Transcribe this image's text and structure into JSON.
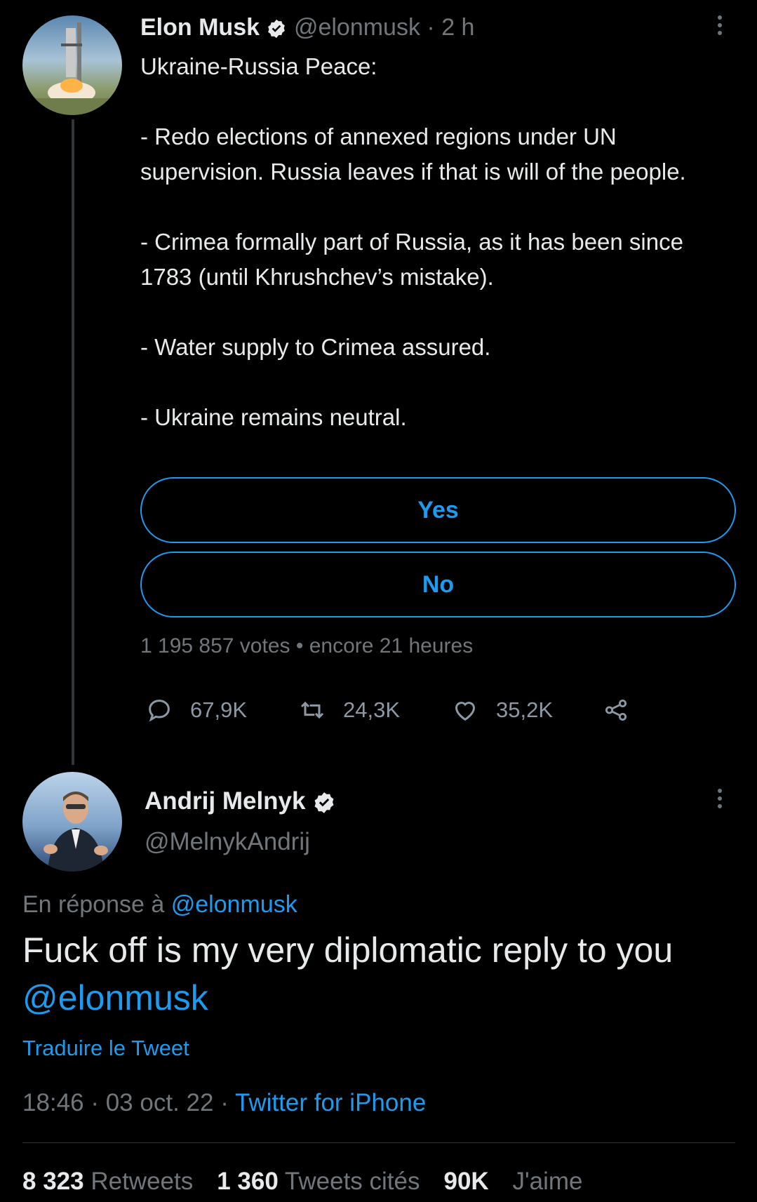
{
  "tweet": {
    "author_name": "Elon Musk",
    "handle": "@elonmusk",
    "separator": "·",
    "time": "2 h",
    "paragraphs": [
      "Ukraine-Russia Peace:",
      "- Redo elections of annexed regions under UN supervision. Russia leaves if that is will of the people.",
      "- Crimea formally part of Russia, as it has been since 1783 (until Khrushchev’s mistake).",
      "- Water supply to Crimea assured.",
      "- Ukraine remains neutral."
    ],
    "poll": {
      "options": [
        "Yes",
        "No"
      ],
      "votes": "1 195 857 votes",
      "bullet": "•",
      "remaining": "encore 21 heures"
    },
    "actions": {
      "replies": "67,9K",
      "retweets": "24,3K",
      "likes": "35,2K"
    }
  },
  "reply": {
    "author_name": "Andrij Melnyk",
    "handle": "@MelnykAndrij",
    "in_reply_to_label": "En réponse à",
    "in_reply_to_handle": "@elonmusk",
    "text": "Fuck off is my very diplomatic reply to you",
    "mention": "@elonmusk",
    "translate": "Traduire le Tweet",
    "time": "18:46",
    "sep": "·",
    "date": "03 oct. 22",
    "source": "Twitter for iPhone",
    "stats": {
      "retweets_count": "8 323",
      "retweets_label": "Retweets",
      "quotes_count": "1 360",
      "quotes_label": "Tweets cités",
      "likes_count": "90K",
      "likes_label": "J'aime"
    }
  },
  "colors": {
    "background": "#000000",
    "text": "#e7e9ea",
    "muted": "#71767b",
    "accent": "#1d9bf0"
  }
}
